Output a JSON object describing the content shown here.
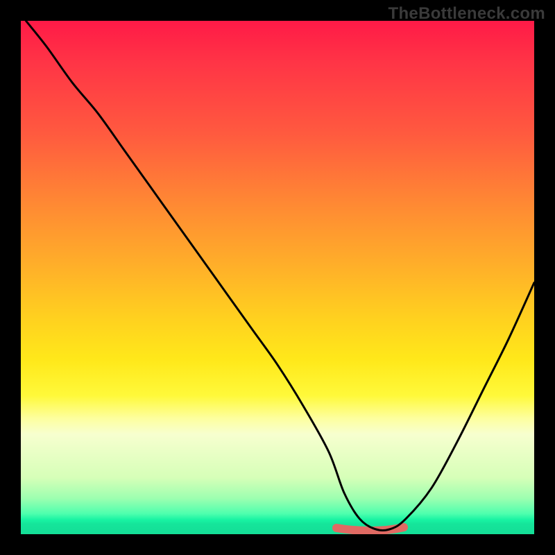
{
  "watermark": "TheBottleneck.com",
  "chart_data": {
    "type": "line",
    "title": "",
    "xlabel": "",
    "ylabel": "",
    "xlim": [
      0,
      100
    ],
    "ylim": [
      0,
      100
    ],
    "grid": false,
    "legend": false,
    "description": "Bottleneck percentage curve on a red-to-green gradient background. Values are approximate percentages; lower is better (green zone near bottom).",
    "series": [
      {
        "name": "bottleneck-curve",
        "x": [
          1,
          5,
          10,
          15,
          20,
          25,
          30,
          35,
          40,
          45,
          50,
          55,
          60,
          63,
          66,
          69,
          72,
          75,
          80,
          85,
          90,
          95,
          100
        ],
        "values": [
          100,
          95,
          88,
          82,
          75,
          68,
          61,
          54,
          47,
          40,
          33,
          25,
          16,
          8,
          3,
          1,
          1,
          3,
          9,
          18,
          28,
          38,
          49
        ]
      }
    ],
    "optimal_band": {
      "x_start": 62,
      "x_end": 75,
      "y": 1
    },
    "gradient_stops": [
      {
        "pct": 0,
        "color": "#ff1a47"
      },
      {
        "pct": 22,
        "color": "#ff5a3f"
      },
      {
        "pct": 48,
        "color": "#ffb029"
      },
      {
        "pct": 66,
        "color": "#ffe81a"
      },
      {
        "pct": 80.5,
        "color": "#f7ffcf"
      },
      {
        "pct": 96,
        "color": "#4effae"
      },
      {
        "pct": 100,
        "color": "#14de97"
      }
    ]
  }
}
